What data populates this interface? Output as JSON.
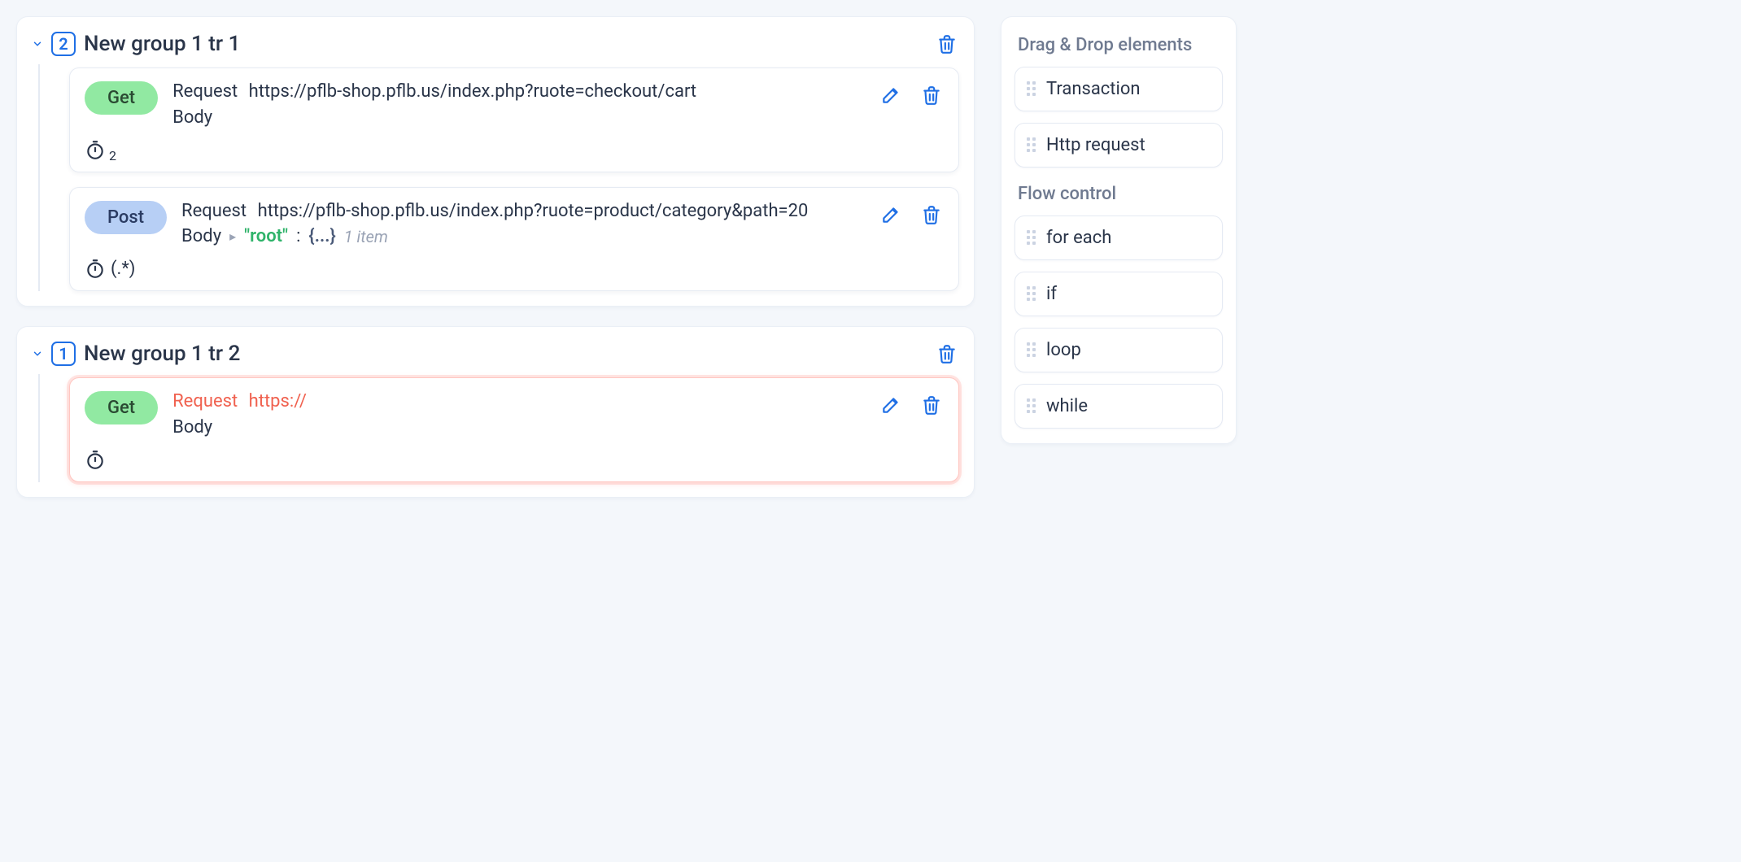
{
  "groups": [
    {
      "count": "2",
      "title": "New group 1 tr 1",
      "requests": [
        {
          "method": "Get",
          "method_class": "get",
          "request_label": "Request",
          "url": "https://pflb-shop.pflb.us/index.php?ruote=checkout/cart",
          "body_label": "Body",
          "has_body_preview": false,
          "footer_text": "",
          "footer_sub": "2",
          "error": false
        },
        {
          "method": "Post",
          "method_class": "post",
          "request_label": "Request",
          "url": "https://pflb-shop.pflb.us/index.php?ruote=product/category&path=20",
          "body_label": "Body",
          "has_body_preview": true,
          "body_key": "\"root\"",
          "body_brace": "{...}",
          "body_count": "1 item",
          "footer_text": "(.*)",
          "footer_sub": "",
          "error": false
        }
      ]
    },
    {
      "count": "1",
      "title": "New group 1 tr 2",
      "requests": [
        {
          "method": "Get",
          "method_class": "get",
          "request_label": "Request",
          "url": "https://",
          "body_label": "Body",
          "has_body_preview": false,
          "footer_text": "",
          "footer_sub": "",
          "error": true
        }
      ]
    }
  ],
  "sidebar": {
    "heading_elements": "Drag & Drop elements",
    "heading_flow": "Flow control",
    "elements": [
      {
        "label": "Transaction"
      },
      {
        "label": "Http request"
      }
    ],
    "flow": [
      {
        "label": "for each"
      },
      {
        "label": "if"
      },
      {
        "label": "loop"
      },
      {
        "label": "while"
      }
    ]
  }
}
